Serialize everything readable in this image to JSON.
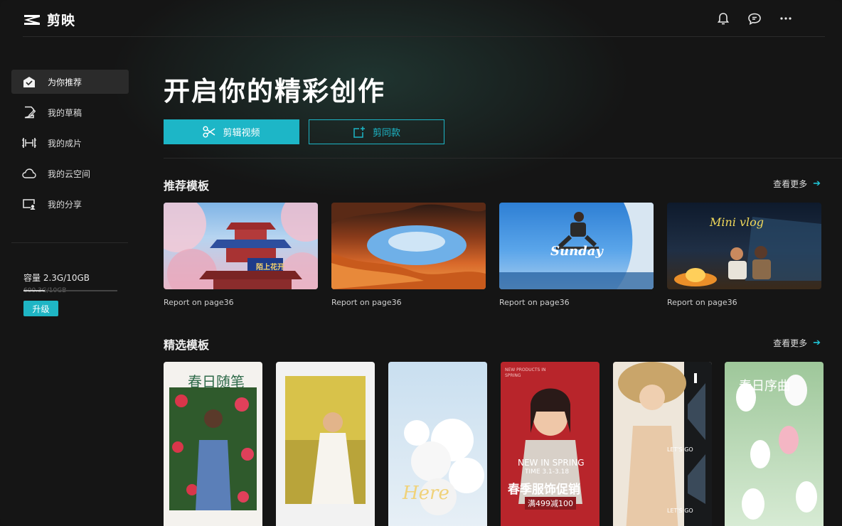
{
  "app": {
    "name": "剪映"
  },
  "topbar": {
    "icons": [
      "bell-icon",
      "message-icon",
      "more-icon"
    ]
  },
  "sidebar": {
    "items": [
      {
        "label": "为你推荐",
        "icon": "home-icon",
        "active": true
      },
      {
        "label": "我的草稿",
        "icon": "draft-icon",
        "active": false
      },
      {
        "label": "我的成片",
        "icon": "film-icon",
        "active": false
      },
      {
        "label": "我的云空间",
        "icon": "cloud-icon",
        "active": false
      },
      {
        "label": "我的分享",
        "icon": "share-icon",
        "active": false
      }
    ],
    "storage": {
      "label": "容量 2.3G/10GB",
      "sub": "600.3G/10GB",
      "used_fraction": 0.23
    },
    "upgrade_label": "升级"
  },
  "hero": {
    "title": "开启你的精彩创作",
    "primary_button": "剪辑视频",
    "secondary_button": "剪同款"
  },
  "recommended": {
    "title": "推荐模板",
    "more": "查看更多",
    "cards": [
      {
        "caption": "Report on page36",
        "overlay": "陌上花开"
      },
      {
        "caption": "Report on page36"
      },
      {
        "caption": "Report on page36",
        "overlay": "Sunday"
      },
      {
        "caption": "Report on page36",
        "overlay": "Mini vlog"
      }
    ]
  },
  "featured": {
    "title": "精选模板",
    "more": "查看更多",
    "cards": [
      {
        "overlay": "春日随笔"
      },
      {
        "overlay": ""
      },
      {
        "overlay": "Here"
      },
      {
        "line1": "NEW IN SPRING",
        "line2": "TIME 3.1-3.18",
        "line3": "春季服饰促销",
        "line4": "满499减100",
        "tag": "NEW PRODUCTS IN SPRING"
      },
      {
        "line1": "LET'S GO",
        "line2": "LET'S GO"
      },
      {
        "overlay": "春日序曲"
      }
    ]
  },
  "colors": {
    "accent": "#1db6c7",
    "background": "#151515",
    "active_nav": "#2b2b2b"
  }
}
